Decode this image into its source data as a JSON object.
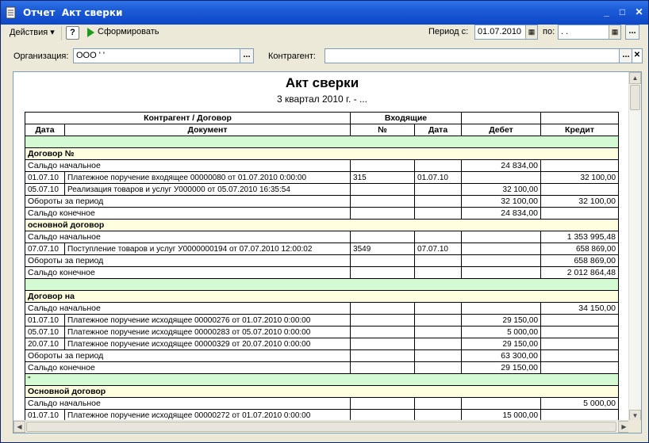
{
  "window": {
    "title": "Отчет  Акт сверки",
    "minimize_glyph": "_",
    "maximize_glyph": "□",
    "close_glyph": "✕"
  },
  "toolbar": {
    "actions_label": "Действия ▾",
    "help_label": "?",
    "generate_label": "Сформировать",
    "period_from_label": "Период с:",
    "period_from_value": "01.07.2010",
    "period_to_label": "по:",
    "period_to_value": " .  .",
    "calendar_glyph": "▦",
    "dots_label": "..."
  },
  "filters": {
    "org_label": "Организация:",
    "org_value": "ООО '                        '",
    "contractor_label": "Контрагент:",
    "contractor_value": "",
    "clear_glyph": "✕"
  },
  "report": {
    "title": "Акт сверки",
    "subtitle": "3 квартал 2010 г. - ...",
    "header_row1": {
      "contractor_contract": "Контрагент / Договор",
      "incoming": "Входящие"
    },
    "header_row2": {
      "date": "Дата",
      "document": "Документ",
      "number": "№",
      "in_date": "Дата",
      "debit": "Дебет",
      "credit": "Кредит"
    },
    "rows": [
      {
        "type": "green"
      },
      {
        "type": "yellow",
        "text": "Договор №"
      },
      {
        "type": "bold",
        "text": "Сальдо начальное",
        "debit": "24 834,00",
        "credit": ""
      },
      {
        "type": "line",
        "date": "01.07.10",
        "doc": "Платежное поручение входящее          00000080 от 01.07.2010 0:00:00",
        "num": "315",
        "in_date": "01.07.10",
        "debit": "",
        "credit": "32 100,00"
      },
      {
        "type": "line",
        "date": "05.07.10",
        "doc": "Реализация товаров и услуг У000000 от 05.07.2010 16:35:54",
        "num": "",
        "in_date": "",
        "debit": "32 100,00",
        "credit": ""
      },
      {
        "type": "bold",
        "text": "Обороты за период",
        "debit": "32 100,00",
        "credit": "32 100,00"
      },
      {
        "type": "bold",
        "text": "Сальдо конечное",
        "debit": "24 834,00",
        "credit": ""
      },
      {
        "type": "yellow",
        "text": "основной договор"
      },
      {
        "type": "bold",
        "text": "Сальдо начальное",
        "debit": "",
        "credit": "1 353 995,48"
      },
      {
        "type": "line",
        "date": "07.07.10",
        "doc": "Поступление товаров и услуг У0000000194 от 07.07.2010 12:00:02",
        "num": "3549",
        "in_date": "07.07.10",
        "debit": "",
        "credit": "658 869,00"
      },
      {
        "type": "bold",
        "text": "Обороты за период",
        "debit": "",
        "credit": "658 869,00"
      },
      {
        "type": "bold",
        "text": "Сальдо конечное",
        "debit": "",
        "credit": "2 012 864,48"
      },
      {
        "type": "green"
      },
      {
        "type": "yellow",
        "text": "Договор на"
      },
      {
        "type": "bold",
        "text": "Сальдо начальное",
        "debit": "",
        "credit": "34 150,00"
      },
      {
        "type": "line",
        "date": "01.07.10",
        "doc": "Платежное поручение исходящее         00000276 от 01.07.2010 0:00:00",
        "num": "",
        "in_date": "",
        "debit": "29 150,00",
        "credit": ""
      },
      {
        "type": "line",
        "date": "05.07.10",
        "doc": "Платежное поручение исходящее         00000283 от 05.07.2010 0:00:00",
        "num": "",
        "in_date": "",
        "debit": "5 000,00",
        "credit": ""
      },
      {
        "type": "line",
        "date": "20.07.10",
        "doc": "Платежное поручение исходящее         00000329 от 20.07.2010 0:00:00",
        "num": "",
        "in_date": "",
        "debit": "29 150,00",
        "credit": ""
      },
      {
        "type": "bold",
        "text": "Обороты за период",
        "debit": "63 300,00",
        "credit": ""
      },
      {
        "type": "bold",
        "text": "Сальдо конечное",
        "debit": "29 150,00",
        "credit": ""
      },
      {
        "type": "green",
        "text": "\""
      },
      {
        "type": "yellow",
        "text": "Основной договор"
      },
      {
        "type": "bold",
        "text": "Сальдо начальное",
        "debit": "",
        "credit": "5 000,00"
      },
      {
        "type": "line",
        "date": "01.07.10",
        "doc": "Платежное поручение исходящее         00000272 от 01.07.2010 0:00:00",
        "num": "",
        "in_date": "",
        "debit": "15 000,00",
        "credit": ""
      }
    ]
  },
  "scroll": {
    "up": "▲",
    "down": "▼",
    "left": "◀",
    "right": "▶"
  }
}
